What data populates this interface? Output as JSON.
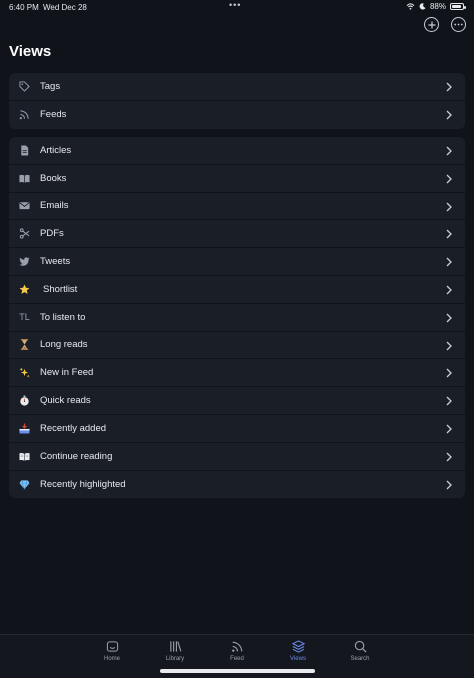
{
  "status": {
    "time": "6:40 PM",
    "date": "Wed Dec 28",
    "battery": "88%",
    "battery_level": 0.88
  },
  "header": {
    "title": "Views"
  },
  "top_actions": {
    "add_icon": "plus-circle-icon",
    "more_icon": "ellipsis-circle-icon"
  },
  "group1": [
    {
      "label": "Tags",
      "icon": "tag-icon"
    },
    {
      "label": "Feeds",
      "icon": "rss-icon"
    }
  ],
  "group2": [
    {
      "label": "Articles",
      "icon": "document-icon"
    },
    {
      "label": "Books",
      "icon": "book-icon"
    },
    {
      "label": "Emails",
      "icon": "envelope-icon"
    },
    {
      "label": "PDFs",
      "icon": "pdf-icon"
    },
    {
      "label": "Tweets",
      "icon": "twitter-icon"
    },
    {
      "label": "Shortlist",
      "icon": "⭐"
    },
    {
      "label": "To listen to",
      "icon": "TL"
    },
    {
      "label": "Long reads",
      "icon": "⌛"
    },
    {
      "label": "New in Feed",
      "icon": "✨"
    },
    {
      "label": "Quick reads",
      "icon": "⏱️"
    },
    {
      "label": "Recently added",
      "icon": "📥"
    },
    {
      "label": "Continue reading",
      "icon": "📖"
    },
    {
      "label": "Recently highlighted",
      "icon": "💎"
    }
  ],
  "tabs": [
    {
      "label": "Home",
      "icon": "home-icon",
      "active": false
    },
    {
      "label": "Library",
      "icon": "library-icon",
      "active": false
    },
    {
      "label": "Feed",
      "icon": "feed-icon",
      "active": false
    },
    {
      "label": "Views",
      "icon": "layers-icon",
      "active": true
    },
    {
      "label": "Search",
      "icon": "search-icon",
      "active": false
    }
  ],
  "colors": {
    "background": "#10131a",
    "card": "#1a1e27",
    "accent": "#6d8ef0"
  }
}
